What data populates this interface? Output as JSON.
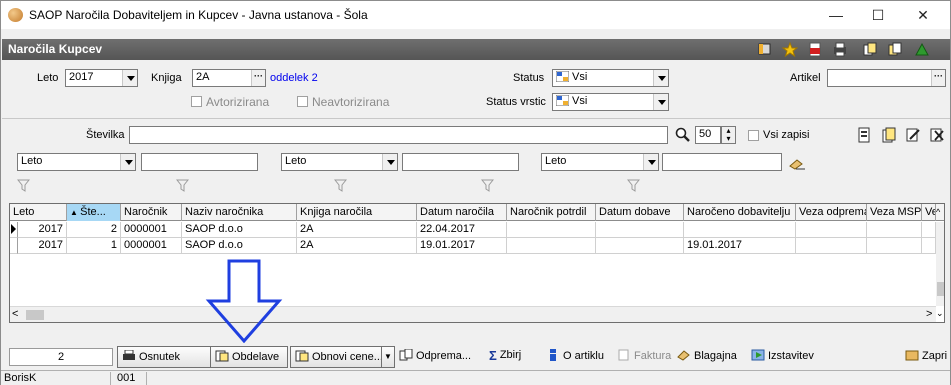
{
  "window": {
    "title": "SAOP  Naročila Dobaviteljem in Kupcev - Javna ustanova - Šola",
    "minimize": "—",
    "maximize": "☐",
    "close": "✕"
  },
  "module": {
    "title": "Naročila Kupcev"
  },
  "filters": {
    "leto_label": "Leto",
    "leto_value": "2017",
    "knjiga_label": "Knjiga",
    "knjiga_value": "2A",
    "knjiga_link": "oddelek 2",
    "status_label": "Status",
    "status_value": "Vsi",
    "artikel_label": "Artikel",
    "artikel_value": "",
    "status_vrstic_label": "Status vrstic",
    "status_vrstic_value": "Vsi",
    "avtorizirana": "Avtorizirana",
    "neavtorizirana": "Neavtorizirana",
    "stevilka_label": "Številka",
    "stevilka_value": "",
    "count_value": "50",
    "vsi_zapisi": "Vsi zapisi",
    "filter1": "Leto",
    "filter2": "Leto",
    "filter3": "Leto"
  },
  "grid": {
    "columns": [
      "Leto",
      "Šte...",
      "Naročnik",
      "Naziv naročnika",
      "Knjiga naročila",
      "Datum naročila",
      "Naročnik potrdil",
      "Datum dobave",
      "Naročeno dobavitelju",
      "Veza odprema",
      "Veza MSP",
      "Ve:"
    ],
    "rows": [
      [
        "2017",
        "2",
        "0000001",
        "SAOP d.o.o",
        "2A",
        "22.04.2017",
        "",
        "",
        "",
        "",
        "",
        ""
      ],
      [
        "2017",
        "1",
        "0000001",
        "SAOP d.o.o",
        "2A",
        "19.01.2017",
        "",
        "",
        "19.01.2017",
        "",
        "",
        ""
      ]
    ]
  },
  "toolbar": {
    "count": "2",
    "osnutek": "Osnutek",
    "obdelave": "Obdelave",
    "obnovi": "Obnovi cene...",
    "odprema": "Odprema...",
    "zbiri": "Zbirj",
    "o_artiklu": "O artiklu",
    "faktura": "Faktura",
    "blagajna": "Blagajna",
    "izstavitev": "Izstavitev",
    "zapri": "Zapri"
  },
  "statusbar": {
    "user": "BorisK",
    "code": "001"
  },
  "colors": {
    "header": "#5f5f5f",
    "sorted": "#a7d8f5",
    "arrow": "#1f3fe0",
    "link": "#0000ee"
  }
}
